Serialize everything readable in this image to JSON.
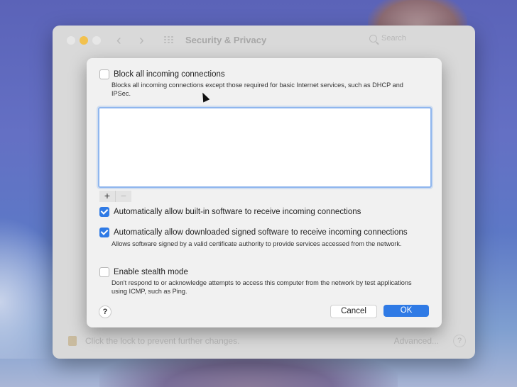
{
  "window": {
    "title": "Security & Privacy",
    "search_placeholder": "Search",
    "bottom_text": "Click the lock to prevent further changes.",
    "advanced_label": "Advanced...",
    "help_label": "?"
  },
  "sheet": {
    "block_all": {
      "label": "Block all incoming connections",
      "checked": false,
      "description": "Blocks all incoming connections except those required for basic Internet services, such as DHCP and IPSec."
    },
    "app_list": [],
    "add_label": "+",
    "remove_label": "−",
    "auto_builtin": {
      "label": "Automatically allow built-in software to receive incoming connections",
      "checked": true
    },
    "auto_signed": {
      "label": "Automatically allow downloaded signed software to receive incoming connections",
      "checked": true,
      "description": "Allows software signed by a valid certificate authority to provide services accessed from the network."
    },
    "stealth": {
      "label": "Enable stealth mode",
      "checked": false,
      "description": "Don't respond to or acknowledge attempts to access this computer from the network by test applications using ICMP, such as Ping."
    },
    "help_label": "?",
    "cancel_label": "Cancel",
    "ok_label": "OK"
  },
  "colors": {
    "accent": "#2f7ae5",
    "traffic_yellow": "#f2c14e"
  }
}
